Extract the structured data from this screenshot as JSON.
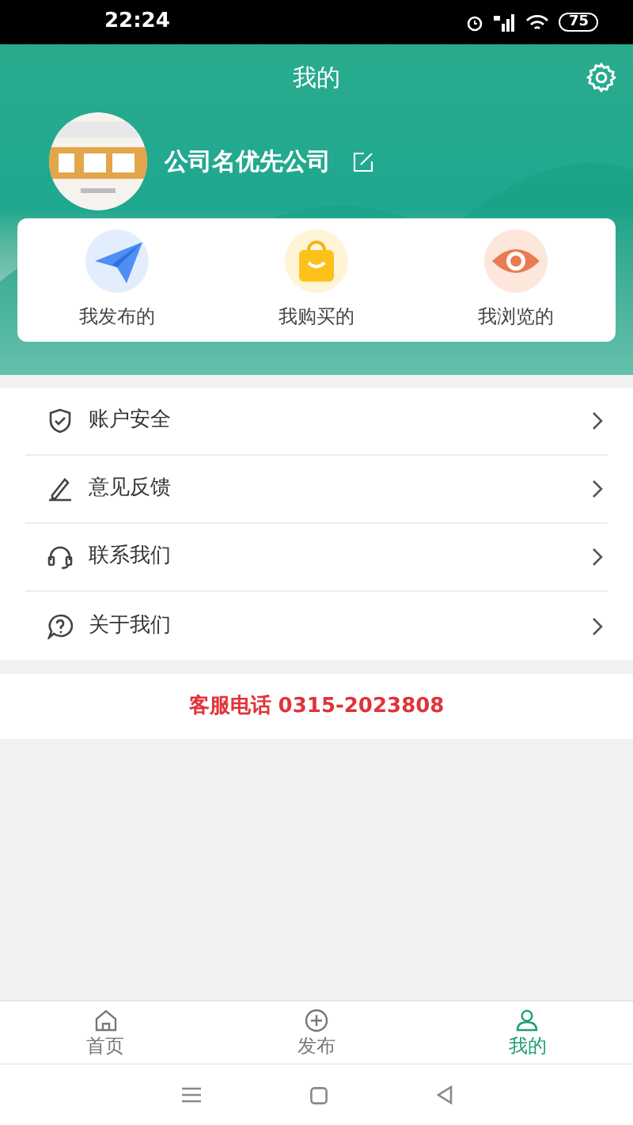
{
  "status_bar": {
    "time": "22:24",
    "battery": "75"
  },
  "header": {
    "title": "我的",
    "company_name": "公司名优先公司"
  },
  "shortcuts": [
    {
      "kind": "plane",
      "label": "我发布的"
    },
    {
      "kind": "bag",
      "label": "我购买的"
    },
    {
      "kind": "eye",
      "label": "我浏览的"
    }
  ],
  "menu": [
    {
      "kind": "shield",
      "label": "账户安全"
    },
    {
      "kind": "pen",
      "label": "意见反馈"
    },
    {
      "kind": "headset",
      "label": "联系我们"
    },
    {
      "kind": "question",
      "label": "关于我们"
    }
  ],
  "hotline": "客服电话 0315-2023808",
  "tab_bar": [
    {
      "kind": "home",
      "label": "首页",
      "selected": false
    },
    {
      "kind": "plus",
      "label": "发布",
      "selected": false
    },
    {
      "kind": "user",
      "label": "我的",
      "selected": true
    }
  ]
}
